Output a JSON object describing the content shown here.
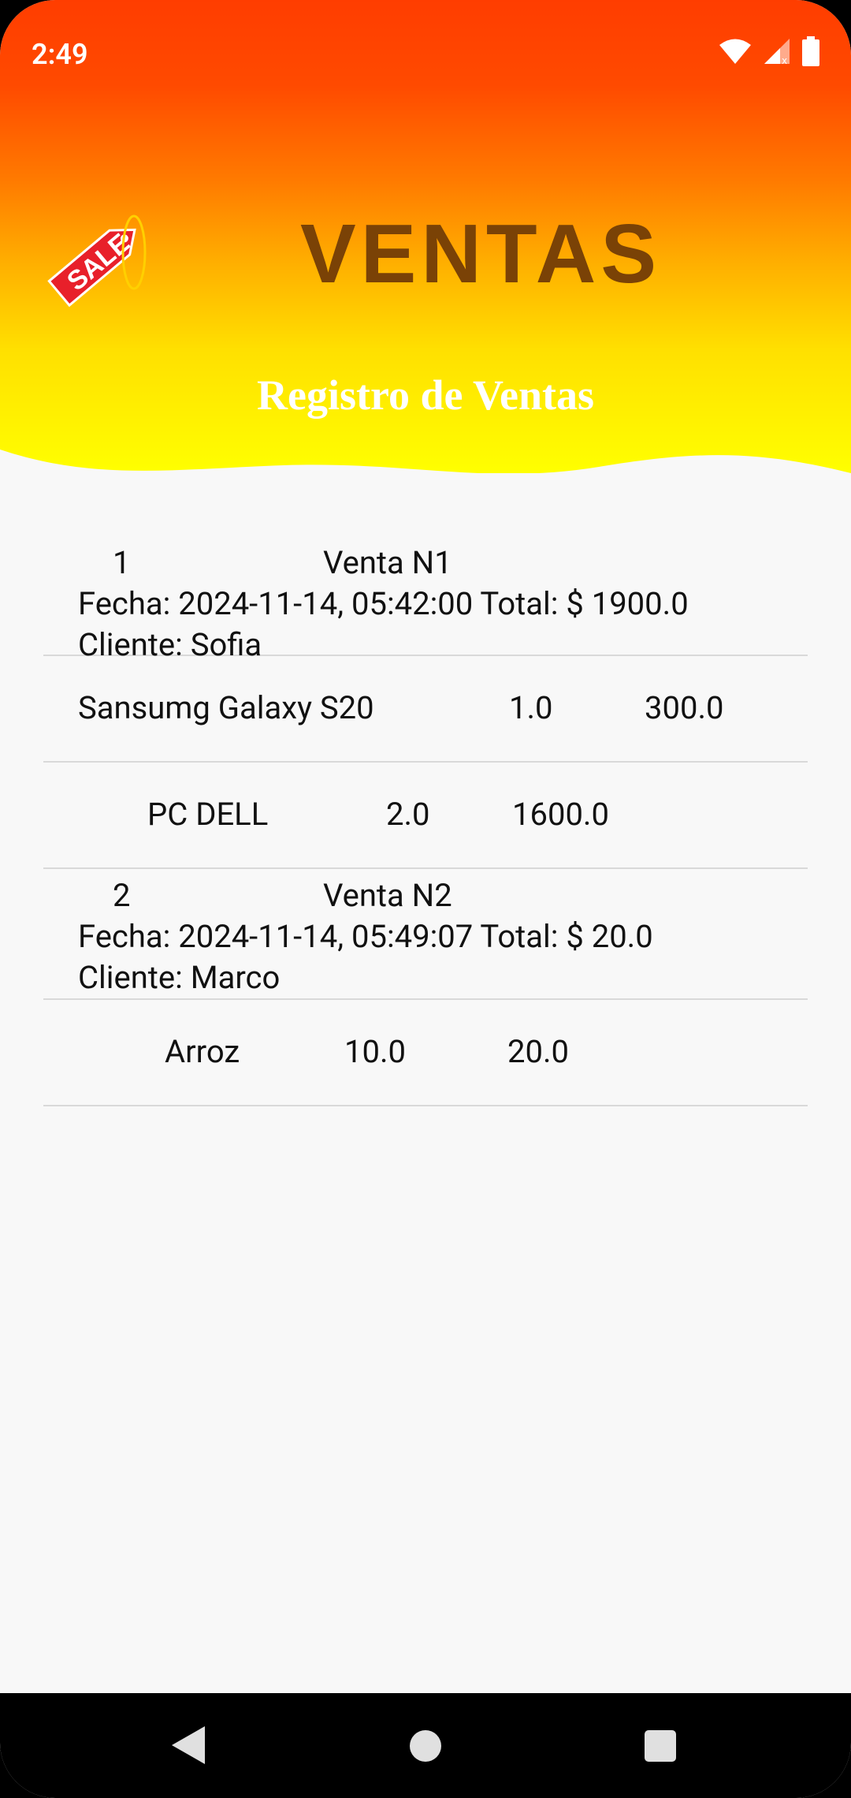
{
  "status_bar": {
    "time": "2:49"
  },
  "header": {
    "badge_text": "SALE",
    "title": "VENTAS",
    "subtitle": "Registro de Ventas"
  },
  "sales": [
    {
      "number": "1",
      "name": "Venta N1",
      "fecha_line": "Fecha: 2024-11-14, 05:42:00 Total: $ 1900.0",
      "cliente_line": "Cliente: Sofia",
      "items": [
        {
          "product": "Sansumg Galaxy S20",
          "qty": "1.0",
          "amount": "300.0"
        },
        {
          "product": "PC DELL",
          "qty": "2.0",
          "amount": "1600.0"
        }
      ]
    },
    {
      "number": "2",
      "name": "Venta N2",
      "fecha_line": "Fecha: 2024-11-14, 05:49:07 Total: $ 20.0",
      "cliente_line": "Cliente: Marco",
      "items": [
        {
          "product": "Arroz",
          "qty": "10.0",
          "amount": "20.0"
        }
      ]
    }
  ],
  "colors": {
    "header_top": "#ff3d00",
    "header_bottom": "#ffff00",
    "title": "#7a4206",
    "background": "#f8f8f8",
    "tag": "#e8202a"
  },
  "icons": [
    "wifi-icon",
    "cell-signal-icon",
    "battery-icon",
    "sale-tag-icon",
    "nav-back-icon",
    "nav-home-icon",
    "nav-recents-icon"
  ]
}
